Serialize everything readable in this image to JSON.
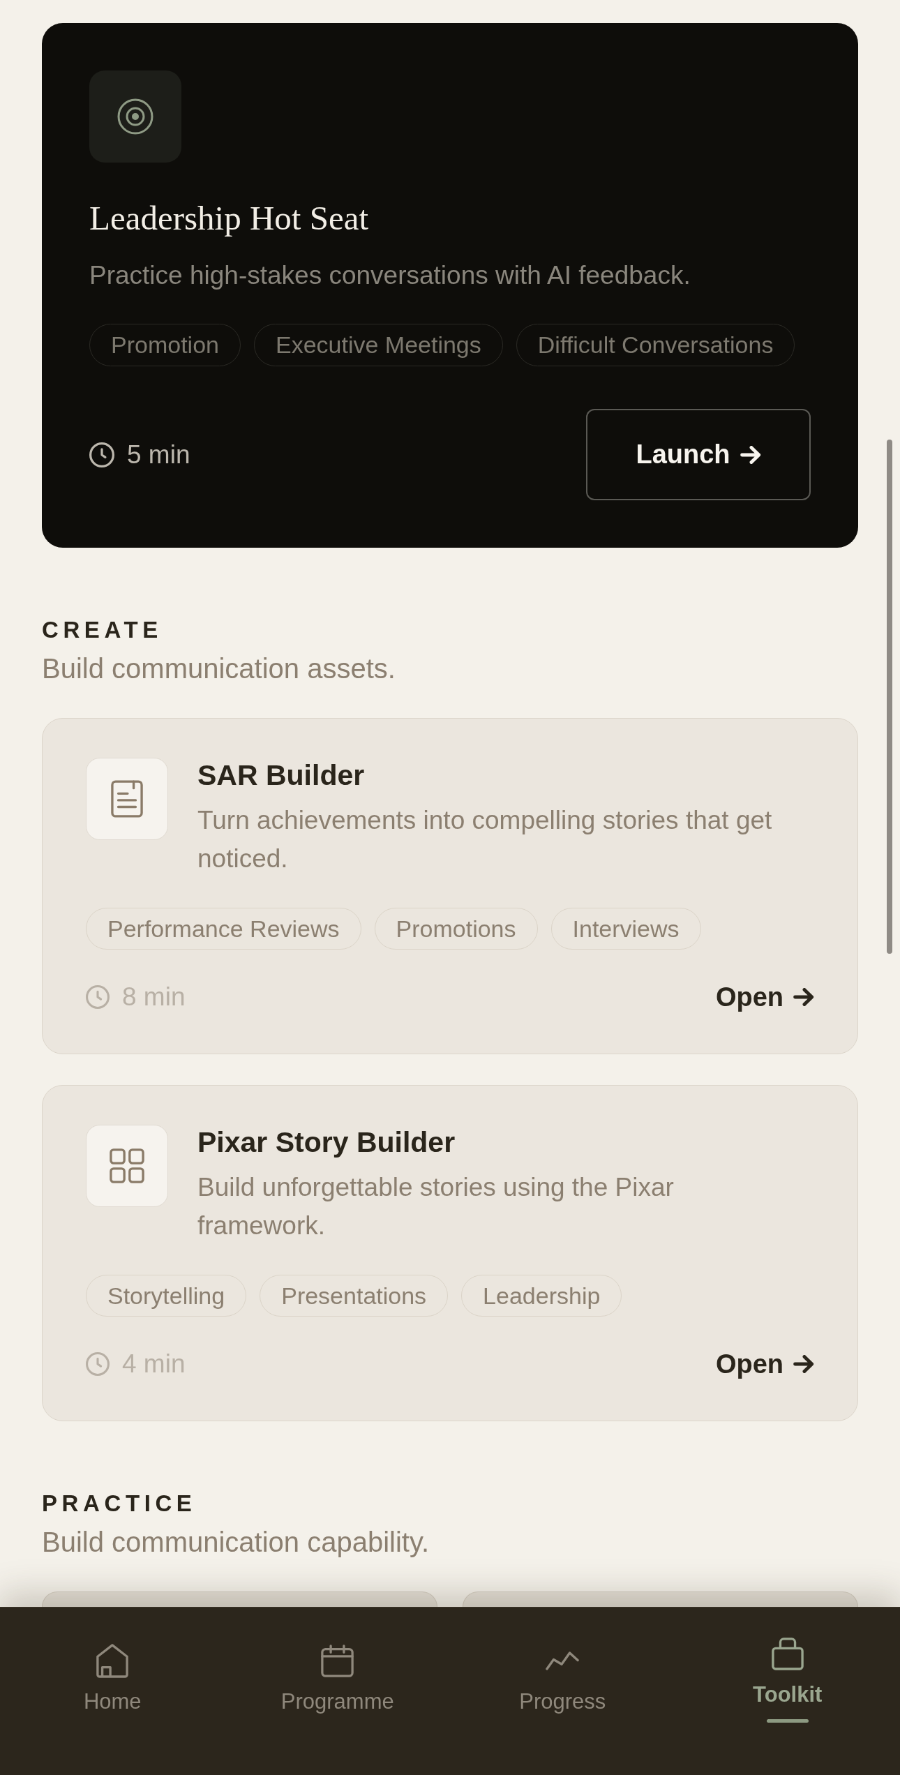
{
  "featured_tool": {
    "title": "Leadership Hot Seat",
    "description": "Practice high-stakes conversations with AI feedback.",
    "tags": [
      "Promotion",
      "Executive Meetings",
      "Difficult Conversations"
    ],
    "duration": "5 min",
    "button": "Launch"
  },
  "sections": [
    {
      "heading": "CREATE",
      "subtitle": "Build communication assets.",
      "tools": [
        {
          "kind": "full",
          "title": "SAR Builder",
          "description": "Turn achievements into compelling stories that get noticed.",
          "tags": [
            "Performance Reviews",
            "Promotions",
            "Interviews"
          ],
          "duration": "8 min",
          "button": "Open"
        },
        {
          "kind": "full",
          "title": "Pixar Story Builder",
          "description": "Build unforgettable stories using the Pixar framework.",
          "tags": [
            "Storytelling",
            "Presentations",
            "Leadership"
          ],
          "duration": "4 min",
          "button": "Open"
        }
      ]
    },
    {
      "heading": "PRACTICE",
      "subtitle": "Build communication capability.",
      "tools": [
        {
          "kind": "cut_off"
        },
        {
          "kind": "cut_off"
        }
      ]
    }
  ],
  "nav": [
    {
      "label": "Home",
      "selected": false
    },
    {
      "label": "Programme",
      "selected": false
    },
    {
      "label": "Progress",
      "selected": false
    },
    {
      "label": "Toolkit",
      "selected": true
    }
  ]
}
